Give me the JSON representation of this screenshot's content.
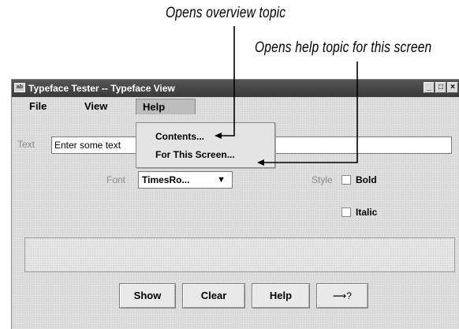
{
  "callouts": {
    "overview": "Opens overview topic",
    "screen_help": "Opens help topic for this screen"
  },
  "window": {
    "title": "Typeface Tester -- Typeface View",
    "icon_text": "ab",
    "controls": {
      "minimize": "_",
      "maximize": "□",
      "close": "×"
    }
  },
  "menubar": {
    "file": "File",
    "view": "View",
    "help": "Help"
  },
  "help_menu": {
    "contents": "Contents...",
    "this_screen": "For This Screen..."
  },
  "form": {
    "text_label": "Text",
    "text_value": "Enter some text",
    "font_label": "Font",
    "font_value": "TimesRo...",
    "style_label": "Style",
    "bold_label": "Bold",
    "italic_label": "Italic",
    "bold_checked": false,
    "italic_checked": false
  },
  "buttons": {
    "show": "Show",
    "clear": "Clear",
    "help": "Help",
    "whats_this": "⟿?"
  },
  "icons": {
    "combo_arrow": "triangle-down-icon",
    "whats_this": "arrow-question-cursor-icon"
  },
  "colors": {
    "titlebar": "#3a3a3a",
    "window_bg": "#dedede",
    "label_gray": "#8a8a8a"
  }
}
